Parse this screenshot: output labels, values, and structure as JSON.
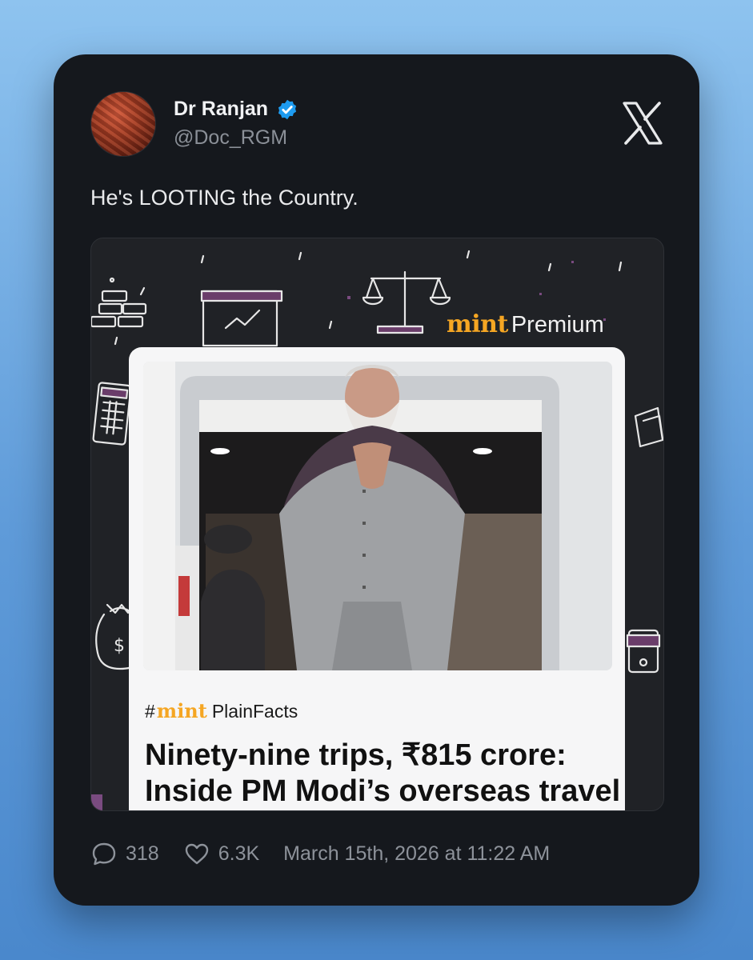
{
  "tweet": {
    "author_name": "Dr Ranjan",
    "author_handle": "@Doc_RGM",
    "text": "He's LOOTING the Country.",
    "replies": "318",
    "likes": "6.3K",
    "timestamp": "March 15th, 2026 at 11:22 AM"
  },
  "media": {
    "brand_mint": "mint",
    "brand_premium": "Premium",
    "hashtag_symbol": "#",
    "hashtag_brand": "mint",
    "hashtag_word": "PlainFacts",
    "headline": "Ninety-nine trips, ₹815 crore: Inside PM Modi’s overseas travel"
  },
  "icons": {
    "verified": "verified-badge-icon",
    "platform": "x-logo-icon",
    "reply": "reply-bubble-icon",
    "like": "heart-icon"
  },
  "colors": {
    "card_bg": "#15181d",
    "verified_blue": "#1d9bf0",
    "mint_orange": "#f5a623",
    "muted_text": "#8d929a"
  }
}
